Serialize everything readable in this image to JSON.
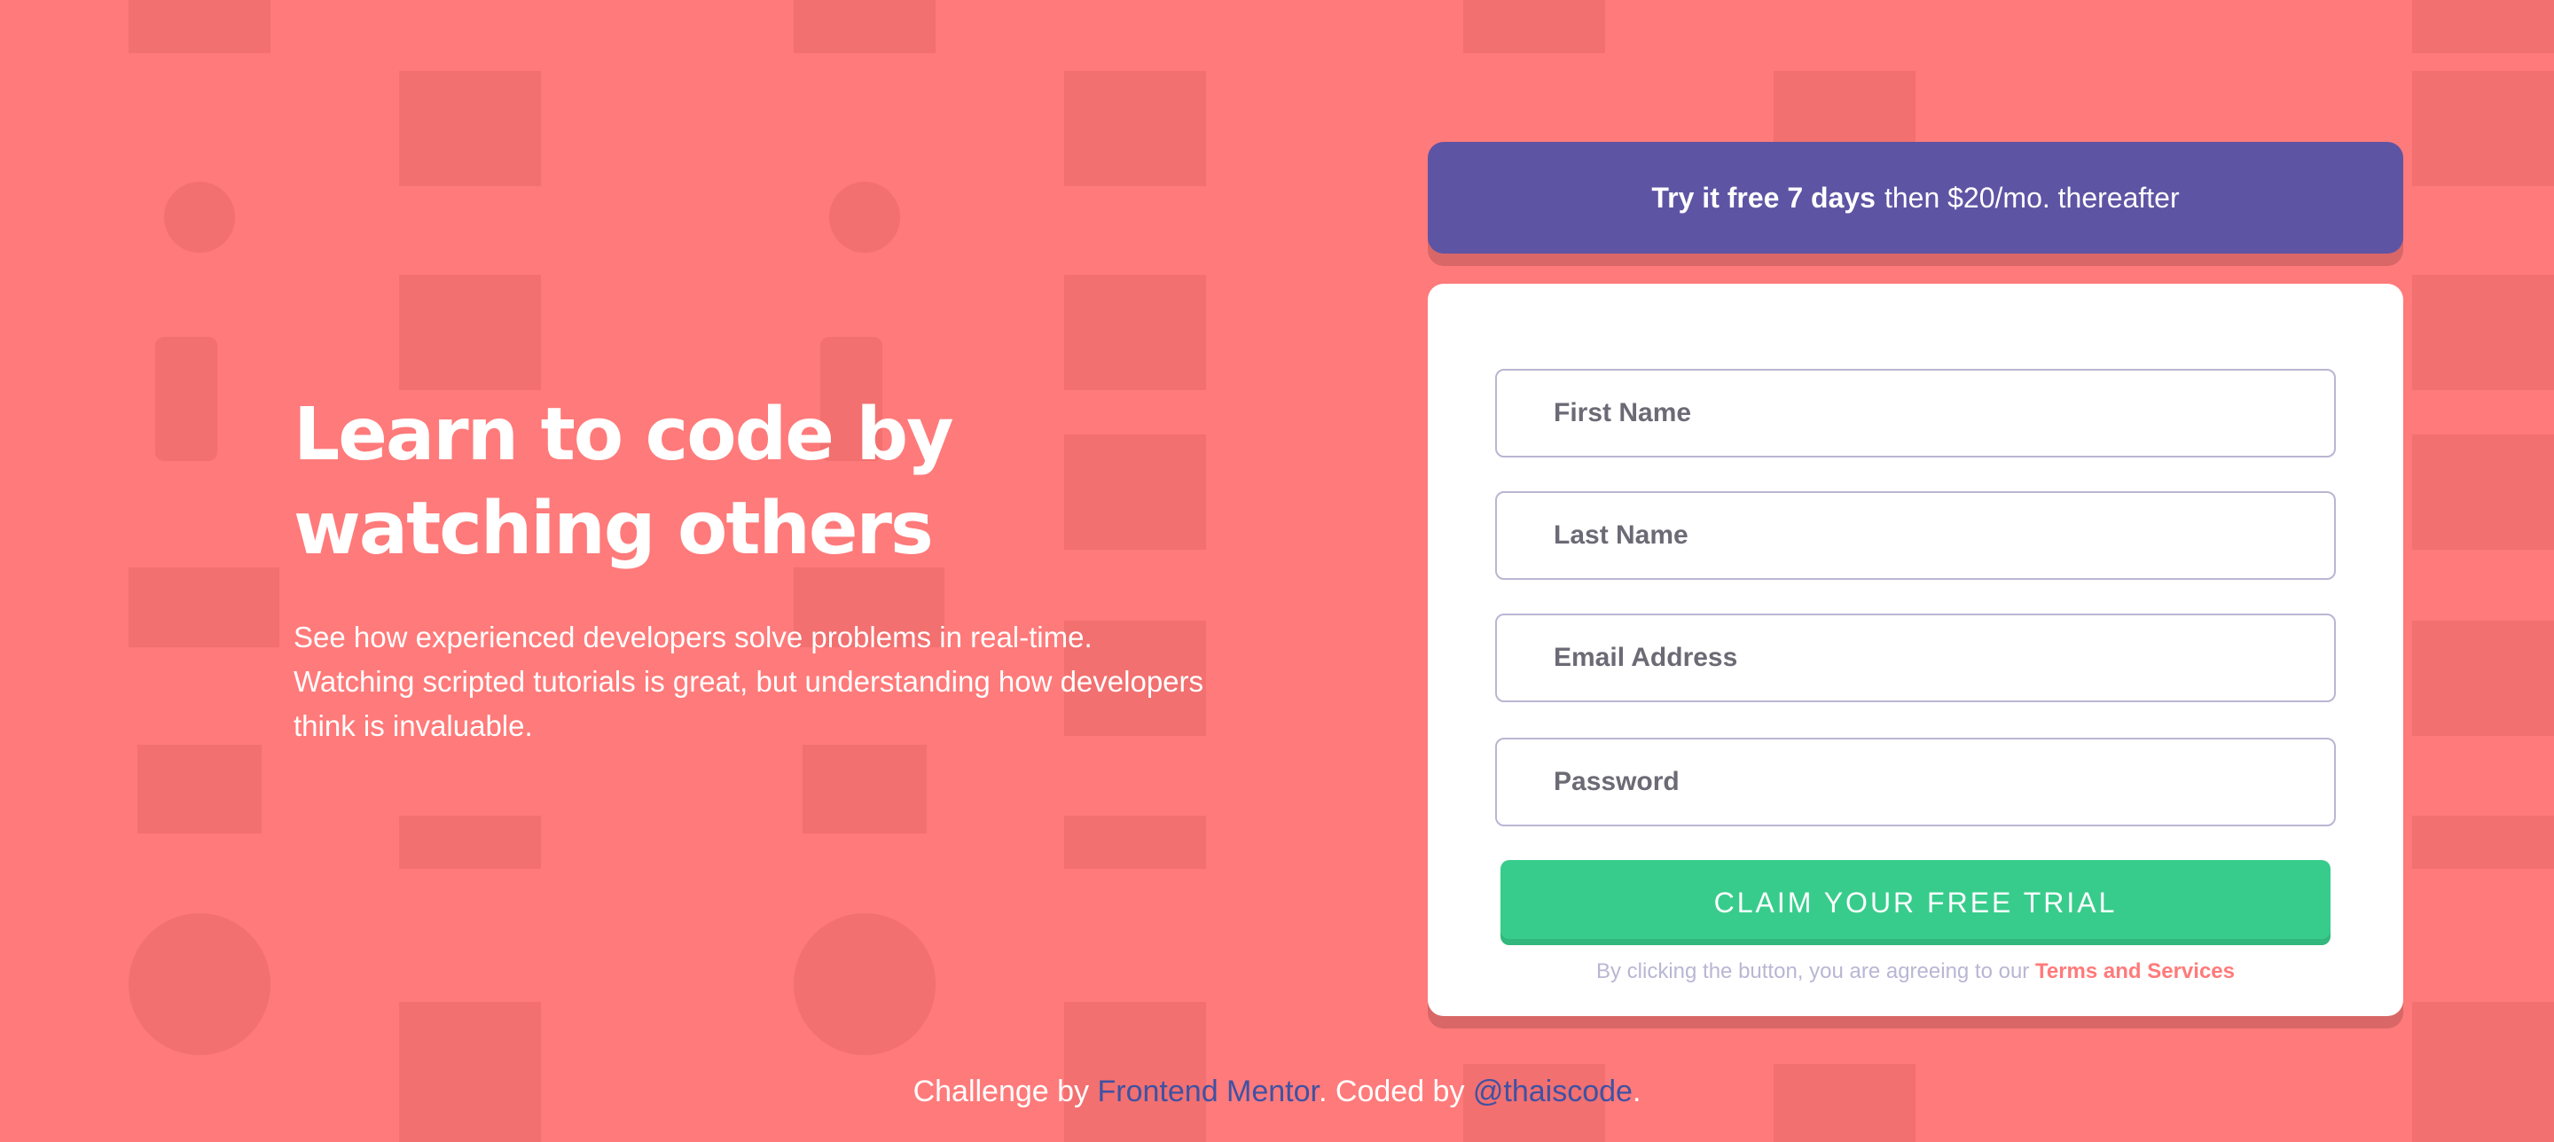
{
  "hero": {
    "title_line1": "Learn to code by",
    "title_line2": "watching others",
    "description": "See how experienced developers solve problems in real-time. Watching scripted tutorials is great, but understanding how developers think is invaluable."
  },
  "promo": {
    "bold": "Try it free 7 days",
    "rest": "then $20/mo. thereafter"
  },
  "form": {
    "first_name_placeholder": "First Name",
    "last_name_placeholder": "Last Name",
    "email_placeholder": "Email Address",
    "password_placeholder": "Password",
    "submit_label": "CLAIM YOUR FREE TRIAL",
    "terms_prefix": "By clicking the button, you are agreeing to our",
    "terms_link": "Terms and Services"
  },
  "footer": {
    "prefix": "Challenge by",
    "mentor_link": "Frontend Mentor",
    "middle": ". Coded by",
    "author_link": "@thaiscode",
    "suffix": "."
  },
  "colors": {
    "background": "#ff7a7a",
    "promo": "#5e54a4",
    "cta": "#38cc8c",
    "border": "#b9b6d3",
    "link": "#3e52a3"
  }
}
